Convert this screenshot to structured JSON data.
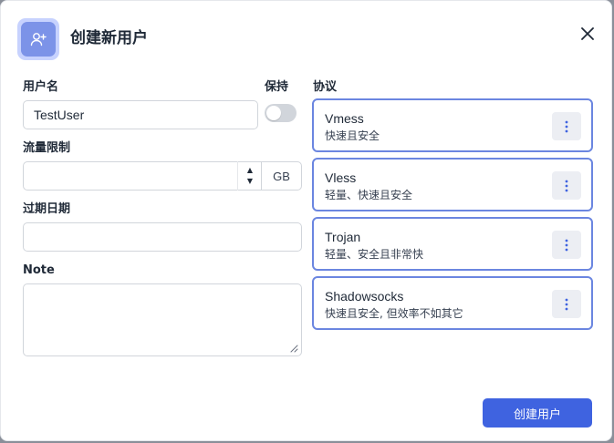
{
  "dialog": {
    "title": "创建新用户",
    "icon": "user-plus-icon"
  },
  "form": {
    "username_label": "用户名",
    "username_value": "TestUser",
    "keep_label": "保持",
    "keep_enabled": false,
    "traffic_label": "流量限制",
    "traffic_value": "",
    "traffic_unit": "GB",
    "expiry_label": "过期日期",
    "expiry_value": "",
    "note_label": "Note",
    "note_value": ""
  },
  "protocols": {
    "label": "协议",
    "items": [
      {
        "name": "Vmess",
        "desc": "快速且安全"
      },
      {
        "name": "Vless",
        "desc": "轻量、快速且安全"
      },
      {
        "name": "Trojan",
        "desc": "轻量、安全且非常快"
      },
      {
        "name": "Shadowsocks",
        "desc": "快速且安全, 但效率不如其它"
      }
    ]
  },
  "actions": {
    "submit_label": "创建用户"
  },
  "colors": {
    "accent": "#3f63e0",
    "selected_border": "#6b86e0",
    "icon_bg": "#7c93e8"
  }
}
